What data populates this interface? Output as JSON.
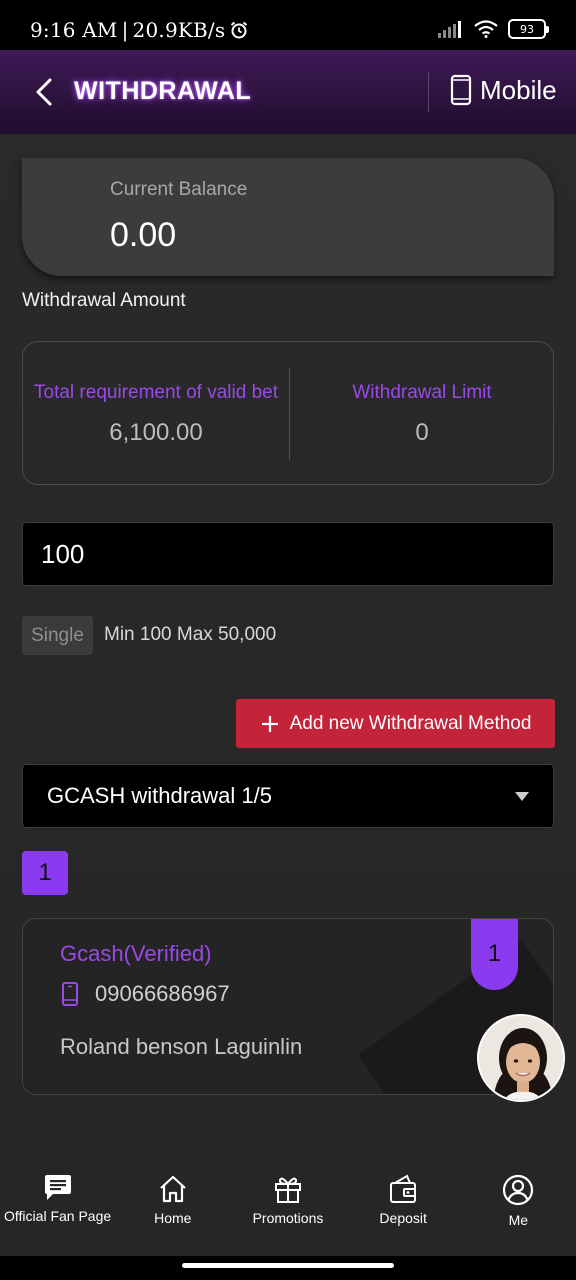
{
  "status_bar": {
    "time": "9:16 AM",
    "separator": "|",
    "speed": "20.9KB/s",
    "battery": "93"
  },
  "header": {
    "title": "WITHDRAWAL",
    "mobile_label": "Mobile"
  },
  "balance": {
    "label": "Current Balance",
    "value": "0.00"
  },
  "withdrawal": {
    "section_label": "Withdrawal Amount",
    "requirement_title": "Total requirement of valid bet",
    "requirement_value": "6,100.00",
    "limit_title": "Withdrawal Limit",
    "limit_value": "0",
    "amount_value": "100",
    "single_tag": "Single",
    "min_max": "Min 100 Max 50,000",
    "add_method_label": "Add new Withdrawal Method",
    "method_selected": "GCASH withdrawal 1/5",
    "page_badge": "1"
  },
  "account": {
    "name": "Gcash(Verified)",
    "phone": "09066686967",
    "holder": "Roland benson Laguinlin",
    "index": "1"
  },
  "nav": [
    {
      "label": "Official Fan Page",
      "icon": "chat-icon"
    },
    {
      "label": "Home",
      "icon": "home-icon"
    },
    {
      "label": "Promotions",
      "icon": "gift-icon"
    },
    {
      "label": "Deposit",
      "icon": "wallet-icon"
    },
    {
      "label": "Me",
      "icon": "user-icon"
    }
  ],
  "colors": {
    "accent_purple": "#9b49e6",
    "badge_purple": "#8a3bf0",
    "button_red": "#c4243a",
    "header_top": "#3e1a56"
  }
}
